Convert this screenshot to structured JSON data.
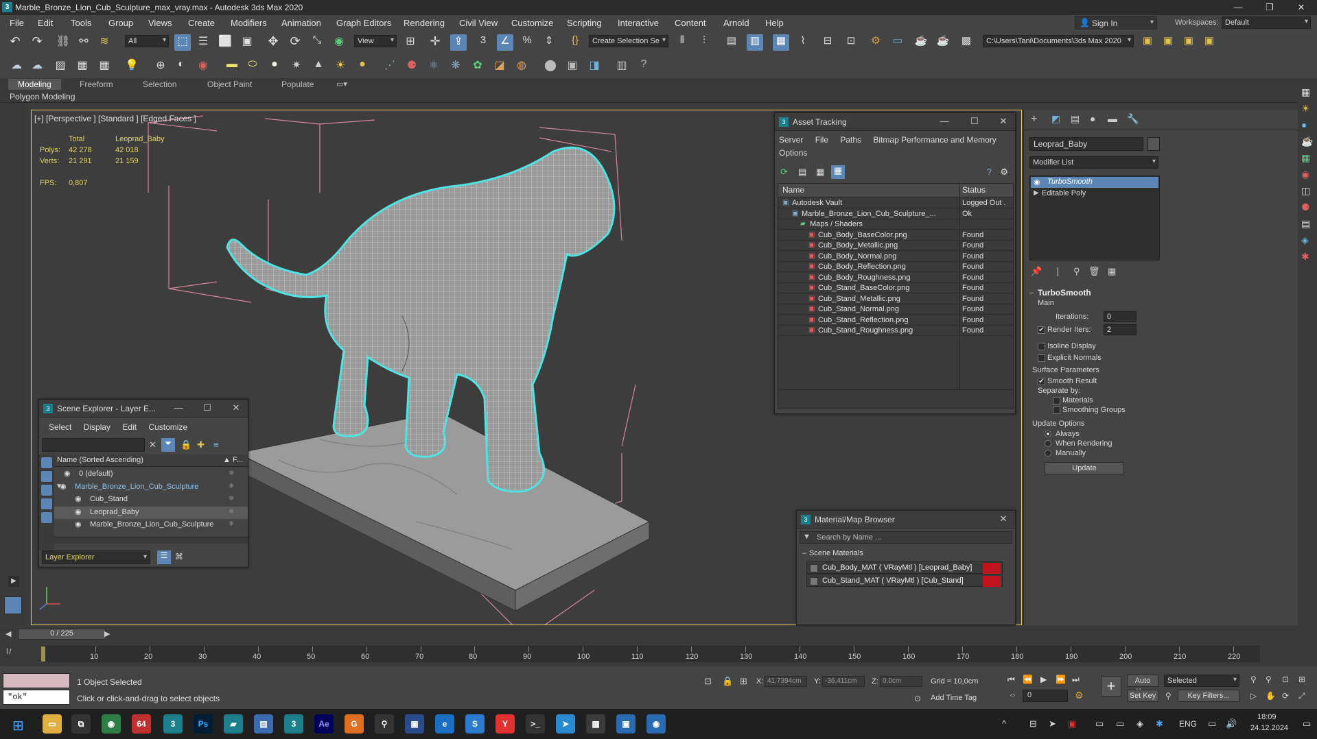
{
  "window": {
    "title": "Marble_Bronze_Lion_Cub_Sculpture_max_vray.max - Autodesk 3ds Max 2020",
    "app_icon": "3",
    "minimize": "—",
    "maximize": "❐",
    "close": "✕"
  },
  "menu": [
    "File",
    "Edit",
    "Tools",
    "Group",
    "Views",
    "Create",
    "Modifiers",
    "Animation",
    "Graph Editors",
    "Rendering",
    "Civil View",
    "Customize",
    "Scripting",
    "Interactive",
    "Content",
    "Arnold",
    "Help"
  ],
  "account": {
    "sign_in": "Sign In",
    "workspaces_label": "Workspaces:",
    "workspace": "Default"
  },
  "toolbar": {
    "filter": "All",
    "ref_coord": "View",
    "selection_set": "Create Selection Se",
    "project_path": "C:\\Users\\Tani\\Documents\\3ds Max 2020"
  },
  "ribbon": {
    "tabs": [
      "Modeling",
      "Freeform",
      "Selection",
      "Object Paint",
      "Populate"
    ],
    "active": "Modeling",
    "sub": "Polygon Modeling"
  },
  "viewport": {
    "label": "[+] [Perspective ] [Standard ] [Edged Faces ]",
    "stats": {
      "col_total": "Total",
      "col_obj": "Leoprad_Baby",
      "polys_label": "Polys:",
      "polys_total": "42 278",
      "polys_obj": "42 018",
      "verts_label": "Verts:",
      "verts_total": "21 291",
      "verts_obj": "21 159",
      "fps_label": "FPS:",
      "fps": "0,807"
    }
  },
  "asset_tracking": {
    "title": "Asset Tracking",
    "menu": [
      "Server",
      "File",
      "Paths",
      "Bitmap Performance and Memory"
    ],
    "menu2": "Options",
    "col_name": "Name",
    "col_status": "Status",
    "rows": [
      {
        "name": "Autodesk Vault",
        "status": "Logged Out ."
      },
      {
        "name": "Marble_Bronze_Lion_Cub_Sculpture_...",
        "status": "Ok"
      },
      {
        "name": "Maps / Shaders",
        "status": ""
      },
      {
        "name": "Cub_Body_BaseColor.png",
        "status": "Found"
      },
      {
        "name": "Cub_Body_Metallic.png",
        "status": "Found"
      },
      {
        "name": "Cub_Body_Normal.png",
        "status": "Found"
      },
      {
        "name": "Cub_Body_Reflection.png",
        "status": "Found"
      },
      {
        "name": "Cub_Body_Roughness.png",
        "status": "Found"
      },
      {
        "name": "Cub_Stand_BaseColor.png",
        "status": "Found"
      },
      {
        "name": "Cub_Stand_Metallic.png",
        "status": "Found"
      },
      {
        "name": "Cub_Stand_Normal.png",
        "status": "Found"
      },
      {
        "name": "Cub_Stand_Reflection.png",
        "status": "Found"
      },
      {
        "name": "Cub_Stand_Roughness.png",
        "status": "Found"
      }
    ]
  },
  "scene_explorer": {
    "title": "Scene Explorer - Layer E...",
    "menu": [
      "Select",
      "Display",
      "Edit",
      "Customize"
    ],
    "col_name": "Name (Sorted Ascending)",
    "col_f": "▲ F...",
    "rows": [
      {
        "name": "0 (default)"
      },
      {
        "name": "Marble_Bronze_Lion_Cub_Sculpture"
      },
      {
        "name": "Cub_Stand"
      },
      {
        "name": "Leoprad_Baby"
      },
      {
        "name": "Marble_Bronze_Lion_Cub_Sculpture"
      }
    ],
    "footer": "Layer Explorer"
  },
  "material_browser": {
    "title": "Material/Map Browser",
    "search_placeholder": "Search by Name ...",
    "group": "Scene Materials",
    "items": [
      "Cub_Body_MAT ( VRayMtl ) [Leoprad_Baby]",
      "Cub_Stand_MAT ( VRayMtl ) [Cub_Stand]"
    ]
  },
  "command_panel": {
    "object_name": "Leoprad_Baby",
    "modifier_list": "Modifier List",
    "stack": [
      "TurboSmooth",
      "Editable Poly"
    ],
    "turbosmooth": {
      "title": "TurboSmooth",
      "main": "Main",
      "iterations_label": "Iterations:",
      "iterations": "0",
      "render_iters_label": "Render Iters:",
      "render_iters": "2",
      "isoline": "Isoline Display",
      "explicit_normals": "Explicit Normals",
      "surface_params": "Surface Parameters",
      "smooth_result": "Smooth Result",
      "separate_by": "Separate by:",
      "materials": "Materials",
      "smoothing_groups": "Smoothing Groups",
      "update_options": "Update Options",
      "always": "Always",
      "when_rendering": "When Rendering",
      "manually": "Manually",
      "update": "Update"
    }
  },
  "timeline": {
    "frame": "0 / 225",
    "ticks": [
      "10",
      "20",
      "30",
      "40",
      "50",
      "60",
      "70",
      "80",
      "90",
      "100",
      "110",
      "120",
      "130",
      "140",
      "150",
      "160",
      "170",
      "180",
      "190",
      "200",
      "210",
      "220"
    ]
  },
  "status": {
    "maxscript": "\"ok\"",
    "selected": "1 Object Selected",
    "prompt": "Click or click-and-drag to select objects",
    "x_label": "X:",
    "x": "41,7394cm",
    "y_label": "Y:",
    "y": "-36,411cm",
    "z_label": "Z:",
    "z": "0,0cm",
    "grid": "Grid = 10,0cm",
    "add_time_tag": "Add Time Tag",
    "auto_key": "Auto Key",
    "set_key": "Set Key",
    "selected_dd": "Selected",
    "key_filters": "Key Filters...",
    "frame_field": "0"
  },
  "taskbar": {
    "lang": "ENG",
    "time": "18:09",
    "date": "24.12.2024",
    "apps": [
      "64",
      "3",
      "Ps",
      "Ae",
      "G"
    ]
  },
  "colors": {
    "accent": "#5b86b6",
    "viewport_border": "#f0d250",
    "selection_outline": "#4fe3e3",
    "stat_text": "#e3d46a",
    "mat_swatch": "#c0141e"
  }
}
